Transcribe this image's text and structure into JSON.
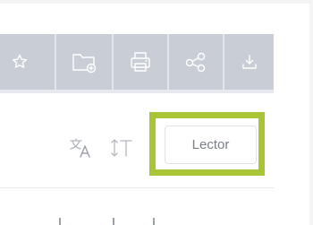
{
  "toolbar": {
    "buttons": [
      {
        "icon": "star-icon"
      },
      {
        "icon": "folder-add-icon"
      },
      {
        "icon": "print-icon"
      },
      {
        "icon": "share-icon"
      },
      {
        "icon": "download-icon"
      }
    ]
  },
  "reader_controls": {
    "translate_icon": "translate-icon",
    "font_size_icon": "font-size-icon",
    "lector_label": "Lector"
  },
  "colors": {
    "toolbar_bg": "#c9ced6",
    "highlight": "#a7c534",
    "lector_text": "#7a7f88"
  }
}
